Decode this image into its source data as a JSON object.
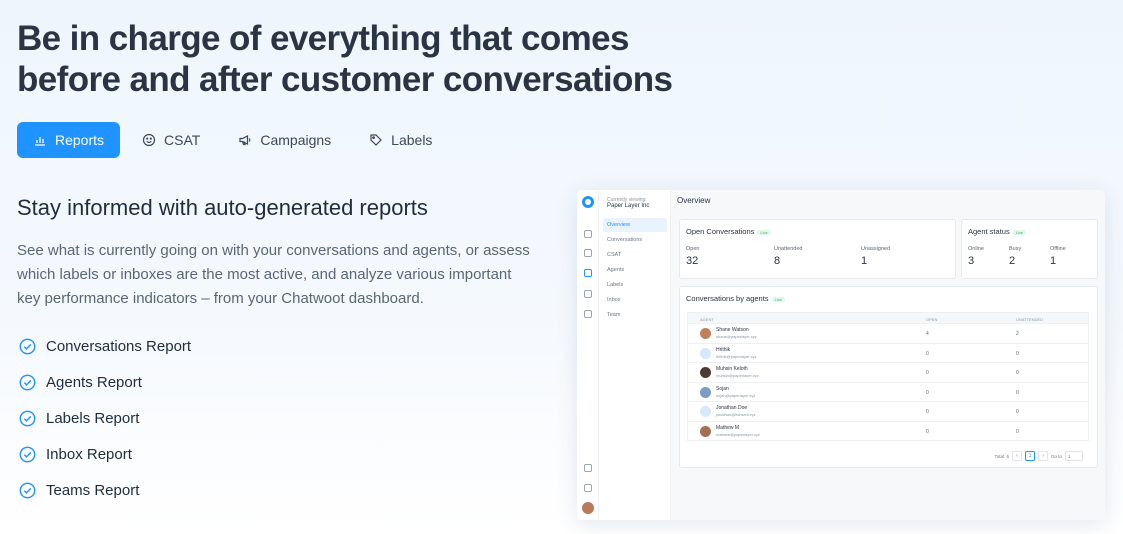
{
  "headline": {
    "line1": "Be in charge of everything that comes",
    "line2": "before and after customer conversations"
  },
  "tabs": [
    {
      "label": "Reports",
      "icon": "bar-chart-icon",
      "active": true
    },
    {
      "label": "CSAT",
      "icon": "smiley-icon",
      "active": false
    },
    {
      "label": "Campaigns",
      "icon": "megaphone-icon",
      "active": false
    },
    {
      "label": "Labels",
      "icon": "tag-icon",
      "active": false
    }
  ],
  "section": {
    "title": "Stay informed with auto-generated reports",
    "description": "See what is currently going on with your conversations and agents, or assess which labels or inboxes are the most active, and analyze various important key performance indicators – from your Chatwoot dashboard."
  },
  "features": [
    "Conversations Report",
    "Agents Report",
    "Labels Report",
    "Inbox Report",
    "Teams Report"
  ],
  "dashboard": {
    "sidebar": {
      "currently_viewing": "Currently viewing:",
      "org": "Paper Layer Inc",
      "items": [
        "Overview",
        "Conversations",
        "CSAT",
        "Agents",
        "Labels",
        "Inbox",
        "Team"
      ]
    },
    "title": "Overview",
    "live_badge": "Live",
    "open_conversations": {
      "title": "Open Conversations",
      "stats": [
        {
          "label": "Open",
          "value": "32"
        },
        {
          "label": "Unattended",
          "value": "8"
        },
        {
          "label": "Unassigned",
          "value": "1"
        }
      ]
    },
    "agent_status": {
      "title": "Agent status",
      "stats": [
        {
          "label": "Online",
          "value": "3"
        },
        {
          "label": "Busy",
          "value": "2"
        },
        {
          "label": "Offline",
          "value": "1"
        }
      ]
    },
    "agents_table": {
      "title": "Conversations by agents",
      "headers": {
        "agent": "AGENT",
        "open": "OPEN",
        "unattended": "UNATTENDED"
      },
      "rows": [
        {
          "name": "Shane Watson",
          "email": "shane@paperlayer.xyz",
          "open": "4",
          "unattended": "2"
        },
        {
          "name": "Hrithik",
          "email": "hrithik@paperlayer.xyz",
          "open": "0",
          "unattended": "0"
        },
        {
          "name": "Muhsin Keloth",
          "email": "muhsin@paperlayer.xyz",
          "open": "0",
          "unattended": "0"
        },
        {
          "name": "Sojan",
          "email": "sojan@paperlayer.xyz",
          "open": "0",
          "unattended": "0"
        },
        {
          "name": "Jonathan Doe",
          "email": "jonathan@fishwell.xyz",
          "open": "0",
          "unattended": "0"
        },
        {
          "name": "Mathew M",
          "email": "mathew@paperlayer.xyz",
          "open": "0",
          "unattended": "0"
        }
      ],
      "pager": {
        "total": "Total: 6",
        "prev": "‹",
        "page": "1",
        "next": "›",
        "goto": "Go to",
        "goto_value": "1"
      }
    }
  },
  "colors": {
    "accent": "#1f93ff",
    "heading": "#2a3443",
    "check": "#1f93ff"
  }
}
